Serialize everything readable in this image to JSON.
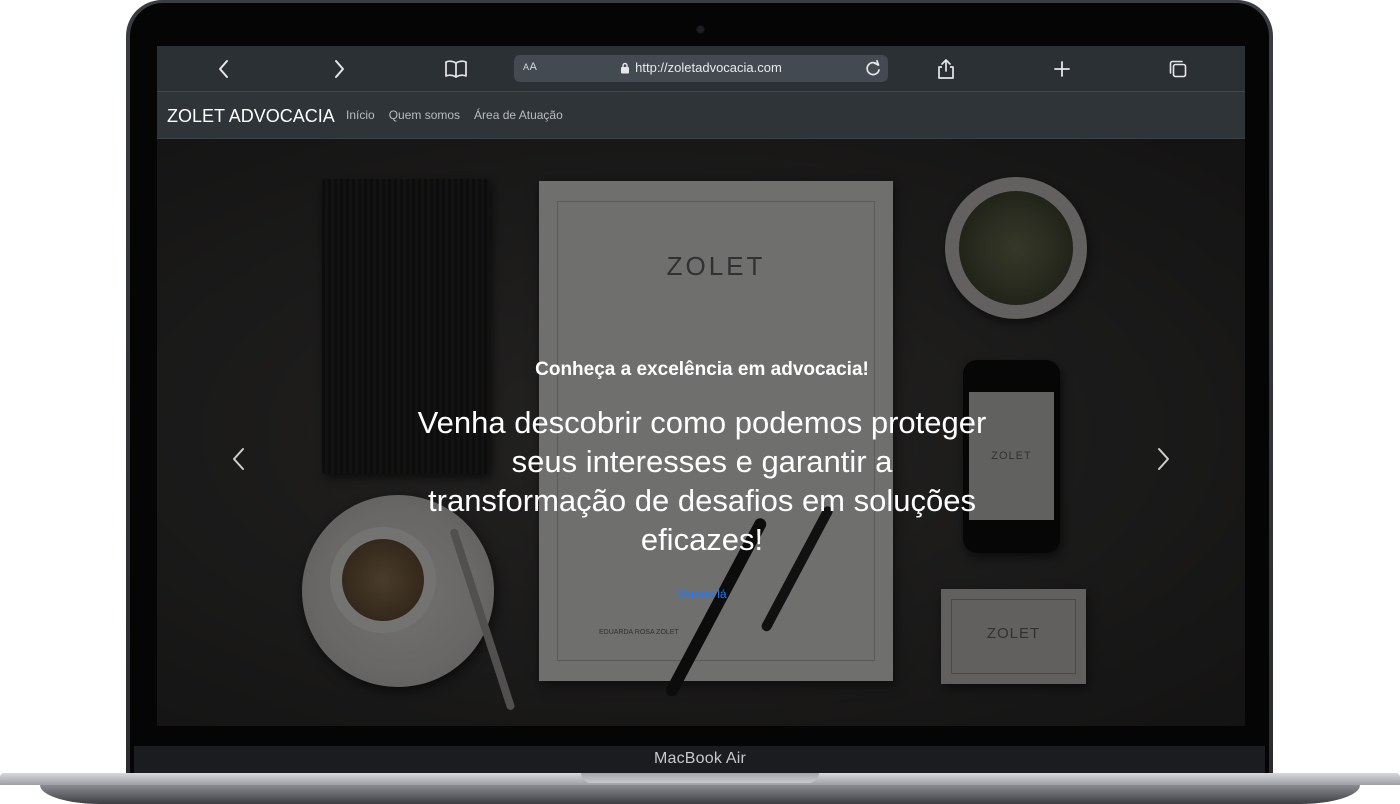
{
  "device": {
    "label": "MacBook Air"
  },
  "browser": {
    "url": "http://zoletadvocacia.com",
    "aa_label": "AA"
  },
  "site": {
    "brand": "ZOLET ADVOCACIA",
    "nav": [
      {
        "label": "Início"
      },
      {
        "label": "Quem somos"
      },
      {
        "label": "Área de Atuação"
      }
    ]
  },
  "hero": {
    "title": "Conheça a excelência em advocacia!",
    "text": "Venha descobrir como podemos proteger seus interesses e garantir a transformação de desafios em soluções eficazes!",
    "cta": "Vamos lá",
    "photo_letter_logo": "ZOLET",
    "photo_phone_logo": "ZOLET",
    "photo_card_logo": "ZOLET",
    "photo_signature": "EDUARDA ROSA ZOLET"
  },
  "colors": {
    "browser_bar": "#2b3035",
    "navbar": "#2f3439",
    "link": "#1e7bff"
  }
}
